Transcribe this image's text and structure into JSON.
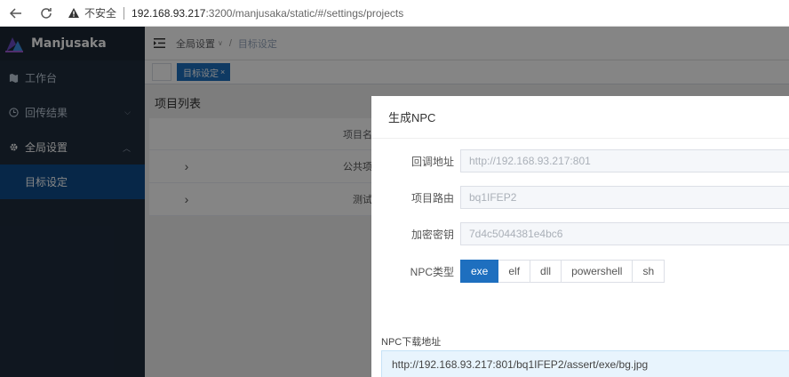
{
  "browser": {
    "insecure_label": "不安全",
    "url_host": "192.168.93.217",
    "url_rest": ":3200/manjusaka/static/#/settings/projects"
  },
  "sidebar": {
    "brand": "Manjusaka",
    "items": [
      {
        "label": "工作台",
        "icon": "map-icon"
      },
      {
        "label": "回传结果",
        "icon": "clock-icon"
      },
      {
        "label": "全局设置",
        "icon": "gear-icon"
      }
    ],
    "sub_items": [
      {
        "label": "目标设定"
      }
    ]
  },
  "header": {
    "breadcrumb_root": "全局设置",
    "breadcrumb_sep": "/",
    "breadcrumb_current": "目标设定"
  },
  "tags": {
    "active_label": "目标设定",
    "close_glyph": "×"
  },
  "content": {
    "title": "项目列表",
    "table": {
      "column_name": "项目名称",
      "rows": [
        {
          "expand": "›",
          "name": "公共项目"
        },
        {
          "expand": "›",
          "name": "测试"
        }
      ]
    }
  },
  "modal": {
    "title": "生成NPC",
    "fields": [
      {
        "label": "回调地址",
        "value": "http://192.168.93.217:801"
      },
      {
        "label": "项目路由",
        "value": "bq1IFEP2"
      },
      {
        "label": "加密密钥",
        "value": "7d4c5044381e4bc6"
      }
    ],
    "npc_type_label": "NPC类型",
    "npc_types": [
      "exe",
      "elf",
      "dll",
      "powershell",
      "sh"
    ],
    "npc_type_selected": "exe",
    "download_label": "NPC下载地址",
    "download_url": "http://192.168.93.217:801/bq1IFEP2/assert/exe/bg.jpg"
  },
  "colors": {
    "sidebar_bg": "#1f2d3d",
    "accent": "#1e6fbf",
    "overlay": "rgba(0,0,0,0.48)"
  }
}
